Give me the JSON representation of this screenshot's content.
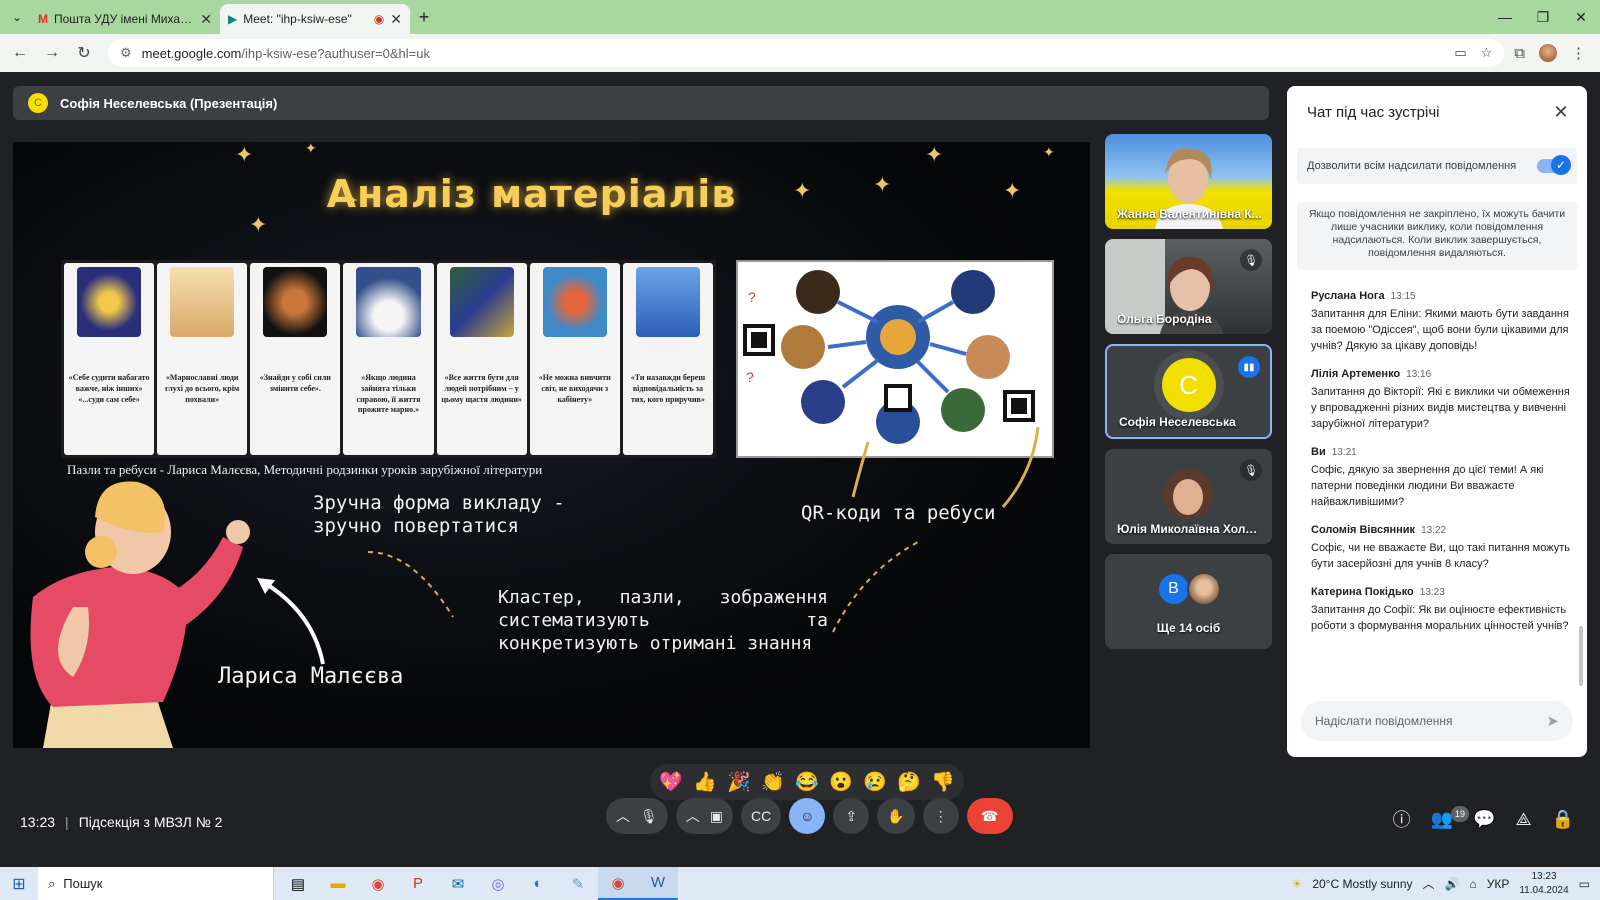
{
  "browser": {
    "tabs": [
      {
        "label": "Пошта УДУ імені Михайла Др",
        "icon": "gmail-icon"
      },
      {
        "label": "Meet: \"ihp-ksiw-ese\"",
        "icon": "meet-icon"
      }
    ],
    "url_host": "meet.google.com",
    "url_path": "/ihp-ksiw-ese?authuser=0&hl=uk"
  },
  "presenter": {
    "label": "Софія Неселевська (Презентація)",
    "avatar_letter": "С"
  },
  "slide": {
    "title": "Аналіз матеріалів",
    "quotes": [
      "«Себе судити набагато важче, ніж інших» «...суди сам себе»",
      "«Марнославні люди глухі до всього, крім похвали»",
      "«Знайди у собі сили змінити себе».",
      "«Якщо людина зайнята тільки справою, її життя прожите марно.»",
      "«Все життя бути для людей потрібним – у цьому щастя людини»",
      "«Не можна вивчити світ, не виходячи з кабінету»",
      "«Ти назавжди береш відповідальність за тих, кого приручив»"
    ],
    "caption": "Пазли та ребуси - Лариса Малєєва, Методичні родзинки уроків зарубіжної літератури",
    "convenient_line1": "Зручна форма викладу -",
    "convenient_line2": "зручно повертатися",
    "qr_label": "QR-коди та ребуси",
    "cluster_text": "Кластер, пазли, зображення систематизують та конкретизують отримані знання",
    "author_name": "Лариса Малєєва"
  },
  "participants": [
    {
      "name": "Жанна Валентинівна К..."
    },
    {
      "name": "Ольга Бородіна"
    },
    {
      "name": "Софія Неселевська",
      "avatar_letter": "С"
    },
    {
      "name": "Юлія Миколаївна Холо..."
    },
    {
      "name": "Ще 14 осіб",
      "avatar_letter": "В"
    }
  ],
  "chat": {
    "title": "Чат під час зустрічі",
    "allow_label": "Дозволити всім надсилати повідомлення",
    "info": "Якщо повідомлення не закріплено, їх можуть бачити лише учасники виклику, коли повідомлення надсилаються. Коли виклик завершується, повідомлення видаляються.",
    "messages": [
      {
        "author": "Руслана Нога",
        "time": "13:15",
        "text": "Запитання для Еліни: Якими мають бути завдання за поемою \"Одіссея\", щоб вони були цікавими для учнів? Дякую за цікаву доповідь!"
      },
      {
        "author": "Лілія Артеменко",
        "time": "13:16",
        "text": "Запитання до Вікторії: Які є виклики чи обмеження у впровадженні різних видів мистецтва у вивченні зарубіжної літератури?"
      },
      {
        "author": "Ви",
        "time": "13:21",
        "text": "Софіє, дякую за звернення до цієї теми! А які патерни поведінки людини Ви вважаєте найважливішими?"
      },
      {
        "author": "Соломія Вівсянник",
        "time": "13:22",
        "text": "Софіє, чи не вважаєте Ви, що такі питання можуть бути засерйозні для учнів 8 класу?"
      },
      {
        "author": "Катерина Покідько",
        "time": "13:23",
        "text": "Запитання до Софії: Як ви оцінюєте ефективність роботи з формування моральних цінностей учнів?"
      }
    ],
    "input_placeholder": "Надіслати повідомлення"
  },
  "reactions": [
    "💖",
    "👍",
    "🎉",
    "👏",
    "😂",
    "😮",
    "😢",
    "🤔",
    "👎"
  ],
  "meeting": {
    "time": "13:23",
    "name": "Підсекція з МВЗЛ № 2",
    "people_count": "19"
  },
  "taskbar": {
    "search_label": "Пошук",
    "weather": "20°C  Mostly sunny",
    "lang": "УКР",
    "clock_time": "13:23",
    "clock_date": "11.04.2024"
  }
}
